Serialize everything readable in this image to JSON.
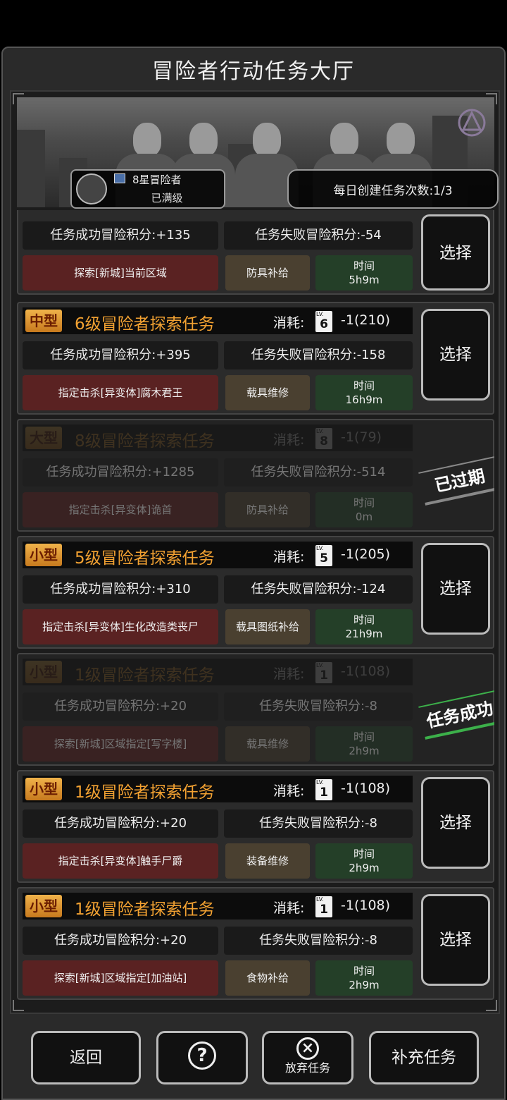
{
  "title": "冒险者行动任务大厅",
  "player": {
    "rank": "8星冒险者",
    "level": "已满级"
  },
  "daily": "每日创建任务次数:1/3",
  "cost_label": "消耗:",
  "select_label": "选择",
  "time_label": "时间",
  "partial": {
    "success": "任务成功冒险积分:+135",
    "fail": "任务失败冒险积分:-54",
    "target": "探索[新城]当前区域",
    "reward": "防具补给",
    "time": "5h9m"
  },
  "tasks": [
    {
      "size": "中型",
      "title": "6级冒险者探索任务",
      "card_level": "6",
      "cost": "-1(210)",
      "success": "任务成功冒险积分:+395",
      "fail": "任务失败冒险积分:-158",
      "target": "指定击杀[异变体]腐木君王",
      "reward": "载具维修",
      "time": "16h9m"
    },
    {
      "size": "大型",
      "title": "8级冒险者探索任务",
      "card_level": "8",
      "cost": "-1(79)",
      "success": "任务成功冒险积分:+1285",
      "fail": "任务失败冒险积分:-514",
      "target": "指定击杀[异变体]诡首",
      "reward": "防具补给",
      "time": "0m",
      "stamp": "已过期"
    },
    {
      "size": "小型",
      "title": "5级冒险者探索任务",
      "card_level": "5",
      "cost": "-1(205)",
      "success": "任务成功冒险积分:+310",
      "fail": "任务失败冒险积分:-124",
      "target": "指定击杀[异变体]生化改造类丧尸",
      "reward": "载具图纸补给",
      "time": "21h9m"
    },
    {
      "size": "小型",
      "title": "1级冒险者探索任务",
      "card_level": "1",
      "cost": "-1(108)",
      "success": "任务成功冒险积分:+20",
      "fail": "任务失败冒险积分:-8",
      "target": "探索[新城]区域指定[写字楼]",
      "reward": "载具维修",
      "time": "2h9m",
      "stamp": "任务成功"
    },
    {
      "size": "小型",
      "title": "1级冒险者探索任务",
      "card_level": "1",
      "cost": "-1(108)",
      "success": "任务成功冒险积分:+20",
      "fail": "任务失败冒险积分:-8",
      "target": "指定击杀[异变体]触手尸爵",
      "reward": "装备维修",
      "time": "2h9m"
    },
    {
      "size": "小型",
      "title": "1级冒险者探索任务",
      "card_level": "1",
      "cost": "-1(108)",
      "success": "任务成功冒险积分:+20",
      "fail": "任务失败冒险积分:-8",
      "target": "探索[新城]区域指定[加油站]",
      "reward": "食物补给",
      "time": "2h9m"
    }
  ],
  "bottom": {
    "back": "返回",
    "help_icon": "?",
    "abandon": "放弃任务",
    "abandon_icon": "×",
    "replenish": "补充任务"
  }
}
